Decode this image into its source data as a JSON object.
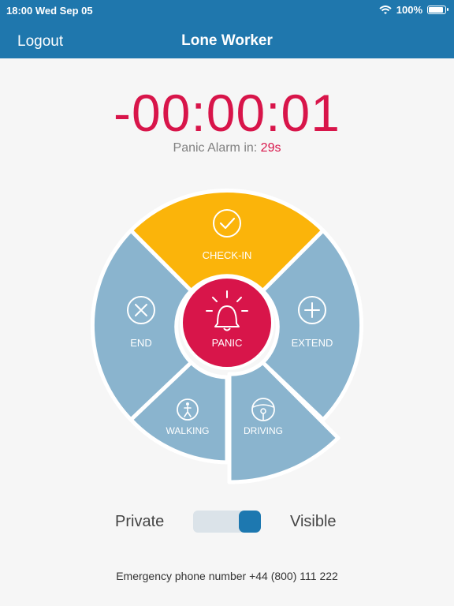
{
  "status_bar": {
    "time": "18:00 Wed Sep 05",
    "battery": "100%",
    "wifi_icon": "wifi-icon",
    "battery_icon": "battery-icon"
  },
  "nav": {
    "logout": "Logout",
    "title": "Lone Worker"
  },
  "timer": {
    "countdown": "-00:00:01",
    "alarm_prefix": "Panic Alarm in: ",
    "alarm_value": "29s"
  },
  "dial": {
    "check_in": {
      "label": "CHECK-IN",
      "icon": "check-circle-icon"
    },
    "end": {
      "label": "END",
      "icon": "x-circle-icon"
    },
    "extend": {
      "label": "EXTEND",
      "icon": "plus-circle-icon"
    },
    "walking": {
      "label": "WALKING",
      "icon": "walking-person-icon"
    },
    "driving": {
      "label": "DRIVING",
      "icon": "steering-wheel-icon"
    },
    "panic": {
      "label": "PANIC",
      "icon": "alarm-bell-icon"
    }
  },
  "visibility": {
    "private_label": "Private",
    "visible_label": "Visible",
    "selected": "Visible"
  },
  "footer": {
    "emergency": "Emergency phone number +44 (800) 111 222"
  },
  "colors": {
    "header": "#1f77ad",
    "accent_red": "#d8154a",
    "checkin_yellow": "#fbb40a",
    "segment_blue": "#8ab4ce"
  }
}
